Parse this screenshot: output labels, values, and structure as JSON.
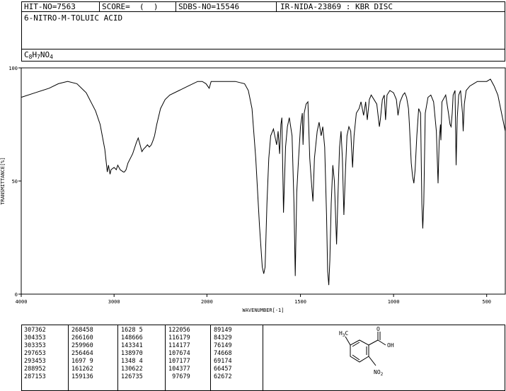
{
  "header": {
    "hit_no": "HIT-NO=7563",
    "score": "SCORE=  (  )",
    "sdbs_no": "SDBS-NO=15546",
    "ir_info": "IR-NIDA-23869 : KBR DISC",
    "compound_name": "6-NITRO-M-TOLUIC ACID",
    "formula_parts": [
      {
        "t": "C",
        "sub": false
      },
      {
        "t": "8",
        "sub": true
      },
      {
        "t": "H",
        "sub": false
      },
      {
        "t": "7",
        "sub": true
      },
      {
        "t": "NO",
        "sub": false
      },
      {
        "t": "4",
        "sub": true
      }
    ]
  },
  "chart_data": {
    "type": "line",
    "title": "",
    "xlabel": "WAVENUMBER[-1]",
    "ylabel": "TRANSMITTANCE[%]",
    "xlim": [
      4000,
      400
    ],
    "ylim": [
      0,
      100
    ],
    "x_ticks": [
      4000,
      3000,
      2000,
      1500,
      1000,
      500
    ],
    "y_ticks": [
      0,
      50,
      100
    ],
    "grid": false,
    "series": [
      {
        "points": [
          [
            4000,
            87
          ],
          [
            3850,
            89
          ],
          [
            3700,
            91
          ],
          [
            3600,
            93
          ],
          [
            3500,
            94
          ],
          [
            3400,
            93
          ],
          [
            3300,
            89
          ],
          [
            3200,
            81
          ],
          [
            3150,
            75
          ],
          [
            3100,
            64
          ],
          [
            3073,
            54
          ],
          [
            3060,
            57
          ],
          [
            3043,
            53
          ],
          [
            3033,
            55
          ],
          [
            3000,
            56
          ],
          [
            2976,
            55
          ],
          [
            2960,
            57
          ],
          [
            2934,
            55
          ],
          [
            2900,
            54
          ],
          [
            2889,
            54
          ],
          [
            2871,
            55
          ],
          [
            2850,
            58
          ],
          [
            2800,
            62
          ],
          [
            2760,
            67
          ],
          [
            2740,
            69
          ],
          [
            2720,
            66
          ],
          [
            2700,
            63
          ],
          [
            2684,
            64
          ],
          [
            2661,
            65
          ],
          [
            2640,
            66
          ],
          [
            2620,
            65
          ],
          [
            2599,
            66
          ],
          [
            2580,
            68
          ],
          [
            2564,
            70
          ],
          [
            2540,
            75
          ],
          [
            2500,
            82
          ],
          [
            2450,
            86
          ],
          [
            2400,
            88
          ],
          [
            2300,
            90
          ],
          [
            2200,
            92
          ],
          [
            2100,
            94
          ],
          [
            2050,
            94
          ],
          [
            2010,
            93
          ],
          [
            1990,
            91
          ],
          [
            1980,
            94
          ],
          [
            1900,
            94
          ],
          [
            1850,
            94
          ],
          [
            1800,
            93
          ],
          [
            1780,
            90
          ],
          [
            1760,
            82
          ],
          [
            1740,
            60
          ],
          [
            1720,
            30
          ],
          [
            1705,
            12
          ],
          [
            1697,
            9
          ],
          [
            1690,
            12
          ],
          [
            1680,
            40
          ],
          [
            1670,
            60
          ],
          [
            1660,
            70
          ],
          [
            1645,
            73
          ],
          [
            1628,
            66
          ],
          [
            1620,
            72
          ],
          [
            1612,
            62
          ],
          [
            1605,
            75
          ],
          [
            1600,
            78
          ],
          [
            1591,
            36
          ],
          [
            1580,
            65
          ],
          [
            1570,
            74
          ],
          [
            1560,
            78
          ],
          [
            1545,
            70
          ],
          [
            1535,
            40
          ],
          [
            1528,
            8
          ],
          [
            1520,
            45
          ],
          [
            1510,
            60
          ],
          [
            1500,
            74
          ],
          [
            1490,
            80
          ],
          [
            1486,
            66
          ],
          [
            1480,
            80
          ],
          [
            1470,
            84
          ],
          [
            1460,
            85
          ],
          [
            1450,
            60
          ],
          [
            1440,
            48
          ],
          [
            1433,
            41
          ],
          [
            1425,
            60
          ],
          [
            1410,
            72
          ],
          [
            1400,
            76
          ],
          [
            1389,
            70
          ],
          [
            1380,
            74
          ],
          [
            1370,
            65
          ],
          [
            1360,
            35
          ],
          [
            1354,
            10
          ],
          [
            1348,
            4
          ],
          [
            1342,
            15
          ],
          [
            1335,
            40
          ],
          [
            1326,
            57
          ],
          [
            1318,
            50
          ],
          [
            1306,
            22
          ],
          [
            1298,
            45
          ],
          [
            1290,
            65
          ],
          [
            1282,
            72
          ],
          [
            1275,
            60
          ],
          [
            1267,
            35
          ],
          [
            1258,
            55
          ],
          [
            1250,
            70
          ],
          [
            1240,
            74
          ],
          [
            1230,
            72
          ],
          [
            1220,
            56
          ],
          [
            1212,
            70
          ],
          [
            1200,
            80
          ],
          [
            1185,
            82
          ],
          [
            1175,
            85
          ],
          [
            1161,
            79
          ],
          [
            1150,
            85
          ],
          [
            1141,
            77
          ],
          [
            1130,
            86
          ],
          [
            1120,
            88
          ],
          [
            1105,
            86
          ],
          [
            1090,
            84
          ],
          [
            1076,
            74
          ],
          [
            1071,
            77
          ],
          [
            1060,
            86
          ],
          [
            1050,
            88
          ],
          [
            1043,
            77
          ],
          [
            1035,
            88
          ],
          [
            1020,
            90
          ],
          [
            1000,
            89
          ],
          [
            985,
            86
          ],
          [
            976,
            79
          ],
          [
            965,
            85
          ],
          [
            950,
            88
          ],
          [
            940,
            89
          ],
          [
            930,
            87
          ],
          [
            920,
            82
          ],
          [
            915,
            75
          ],
          [
            905,
            58
          ],
          [
            898,
            52
          ],
          [
            891,
            49
          ],
          [
            884,
            55
          ],
          [
            875,
            70
          ],
          [
            865,
            82
          ],
          [
            855,
            80
          ],
          [
            848,
            40
          ],
          [
            843,
            29
          ],
          [
            838,
            40
          ],
          [
            830,
            80
          ],
          [
            815,
            87
          ],
          [
            800,
            88
          ],
          [
            785,
            85
          ],
          [
            770,
            72
          ],
          [
            761,
            49
          ],
          [
            755,
            68
          ],
          [
            748,
            75
          ],
          [
            746,
            68
          ],
          [
            740,
            85
          ],
          [
            720,
            88
          ],
          [
            705,
            80
          ],
          [
            697,
            75
          ],
          [
            691,
            74
          ],
          [
            685,
            80
          ],
          [
            680,
            88
          ],
          [
            670,
            90
          ],
          [
            664,
            57
          ],
          [
            658,
            78
          ],
          [
            650,
            88
          ],
          [
            640,
            90
          ],
          [
            630,
            80
          ],
          [
            626,
            72
          ],
          [
            620,
            84
          ],
          [
            610,
            90
          ],
          [
            590,
            92
          ],
          [
            570,
            93
          ],
          [
            550,
            94
          ],
          [
            500,
            94
          ],
          [
            480,
            95
          ],
          [
            460,
            92
          ],
          [
            440,
            88
          ],
          [
            420,
            80
          ],
          [
            400,
            72
          ]
        ]
      }
    ]
  },
  "peak_table": {
    "columns": [
      [
        [
          "3073",
          "62"
        ],
        [
          "3043",
          "53"
        ],
        [
          "3033",
          "53"
        ],
        [
          "2976",
          "53"
        ],
        [
          "2934",
          "53"
        ],
        [
          "2889",
          "52"
        ],
        [
          "2871",
          "53"
        ]
      ],
      [
        [
          "2684",
          "58"
        ],
        [
          "2661",
          "60"
        ],
        [
          "2599",
          "60"
        ],
        [
          "2564",
          "64"
        ],
        [
          "1697",
          "9"
        ],
        [
          "1612",
          "62"
        ],
        [
          "1591",
          "36"
        ]
      ],
      [
        [
          "1628",
          "5"
        ],
        [
          "1486",
          "66"
        ],
        [
          "1433",
          "41"
        ],
        [
          "1389",
          "70"
        ],
        [
          "1348",
          "4"
        ],
        [
          "1306",
          "22"
        ],
        [
          "1267",
          "35"
        ]
      ],
      [
        [
          "1220",
          "56"
        ],
        [
          "1161",
          "79"
        ],
        [
          "1141",
          "77"
        ],
        [
          "1076",
          "74"
        ],
        [
          "1071",
          "77"
        ],
        [
          "1043",
          "77"
        ],
        [
          "976",
          "79"
        ]
      ],
      [
        [
          "891",
          "49"
        ],
        [
          "843",
          "29"
        ],
        [
          "761",
          "49"
        ],
        [
          "746",
          "68"
        ],
        [
          "691",
          "74"
        ],
        [
          "664",
          "57"
        ],
        [
          "626",
          "72"
        ]
      ]
    ]
  },
  "structure": {
    "ch3_label": "H3C",
    "o_label": "O",
    "oh_label": "OH",
    "no2_label": "NO2"
  }
}
